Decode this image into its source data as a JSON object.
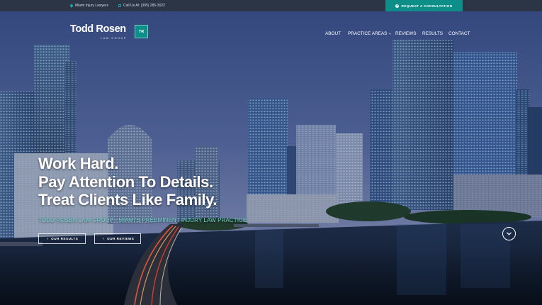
{
  "topbar": {
    "location_label": "Miami Injury Lawyers",
    "location_icon": "map-pin-icon",
    "phone_label": "Call Us At: (305) 285-3022",
    "phone_icon": "phone-icon",
    "cta_label": "REQUEST A CONSULTATION",
    "cta_icon": "plus-circle-icon"
  },
  "logo": {
    "name": "Todd Rosen",
    "subtitle": "LAW GROUP",
    "badge": "TR"
  },
  "nav": {
    "items": [
      {
        "label": "ABOUT"
      },
      {
        "label": "PRACTICE AREAS",
        "has_dropdown": true
      },
      {
        "label": "REVIEWS"
      },
      {
        "label": "RESULTS"
      },
      {
        "label": "CONTACT"
      }
    ]
  },
  "hero": {
    "headline": [
      "Work Hard.",
      "Pay Attention To Details.",
      "Treat Clients Like Family."
    ],
    "tagline": "TODD ROSEN LAW GROUP - MIAMI'S PREEMINENT INJURY LAW PRACTICE",
    "buttons": [
      {
        "label": "OUR RESULTS",
        "icon": "chevron-right-icon"
      },
      {
        "label": "OUR REVIEWS",
        "icon": "chevron-right-icon"
      }
    ],
    "scroll_icon": "chevron-down-circle-icon"
  },
  "colors": {
    "accent": "#0e8e89",
    "accent_light": "#6fd3cf",
    "topbar": "#2b3545",
    "sky_top": "#3a4f86",
    "water": "#101c2e"
  }
}
